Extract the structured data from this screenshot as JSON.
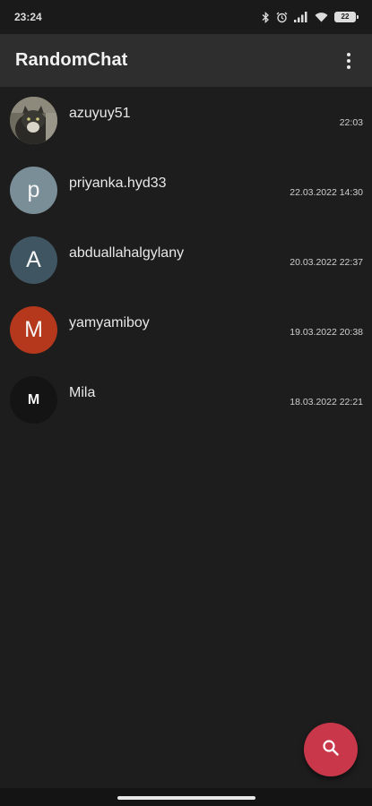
{
  "status_bar": {
    "time": "23:24",
    "battery": "22",
    "icons": [
      "bluetooth-icon",
      "alarm-icon",
      "signal-icon",
      "wifi-icon",
      "battery-icon"
    ]
  },
  "app_bar": {
    "title": "RandomChat",
    "menu_icon": "more-vert-icon"
  },
  "chats": [
    {
      "name": "azuyuy51",
      "time": "22:03",
      "avatar_letter": "",
      "avatar_type": "photo",
      "avatar_color": "#6b6a5e"
    },
    {
      "name": "priyanka.hyd33",
      "time": "22.03.2022 14:30",
      "avatar_letter": "p",
      "avatar_type": "letter",
      "avatar_color": "#7a8e98"
    },
    {
      "name": "abduallahalgylany",
      "time": "20.03.2022 22:37",
      "avatar_letter": "A",
      "avatar_type": "letter",
      "avatar_color": "#3f5562"
    },
    {
      "name": "yamyamiboy",
      "time": "19.03.2022 20:38",
      "avatar_letter": "M",
      "avatar_type": "letter",
      "avatar_color": "#b5371c"
    },
    {
      "name": "Mila",
      "time": "18.03.2022 22:21",
      "avatar_letter": "M",
      "avatar_type": "letter",
      "avatar_color": "#141414"
    }
  ],
  "fab": {
    "icon": "search-icon",
    "color": "#c8374a"
  },
  "colors": {
    "background": "#1d1d1d",
    "app_bar": "#2e2e2e",
    "accent": "#c8374a"
  }
}
